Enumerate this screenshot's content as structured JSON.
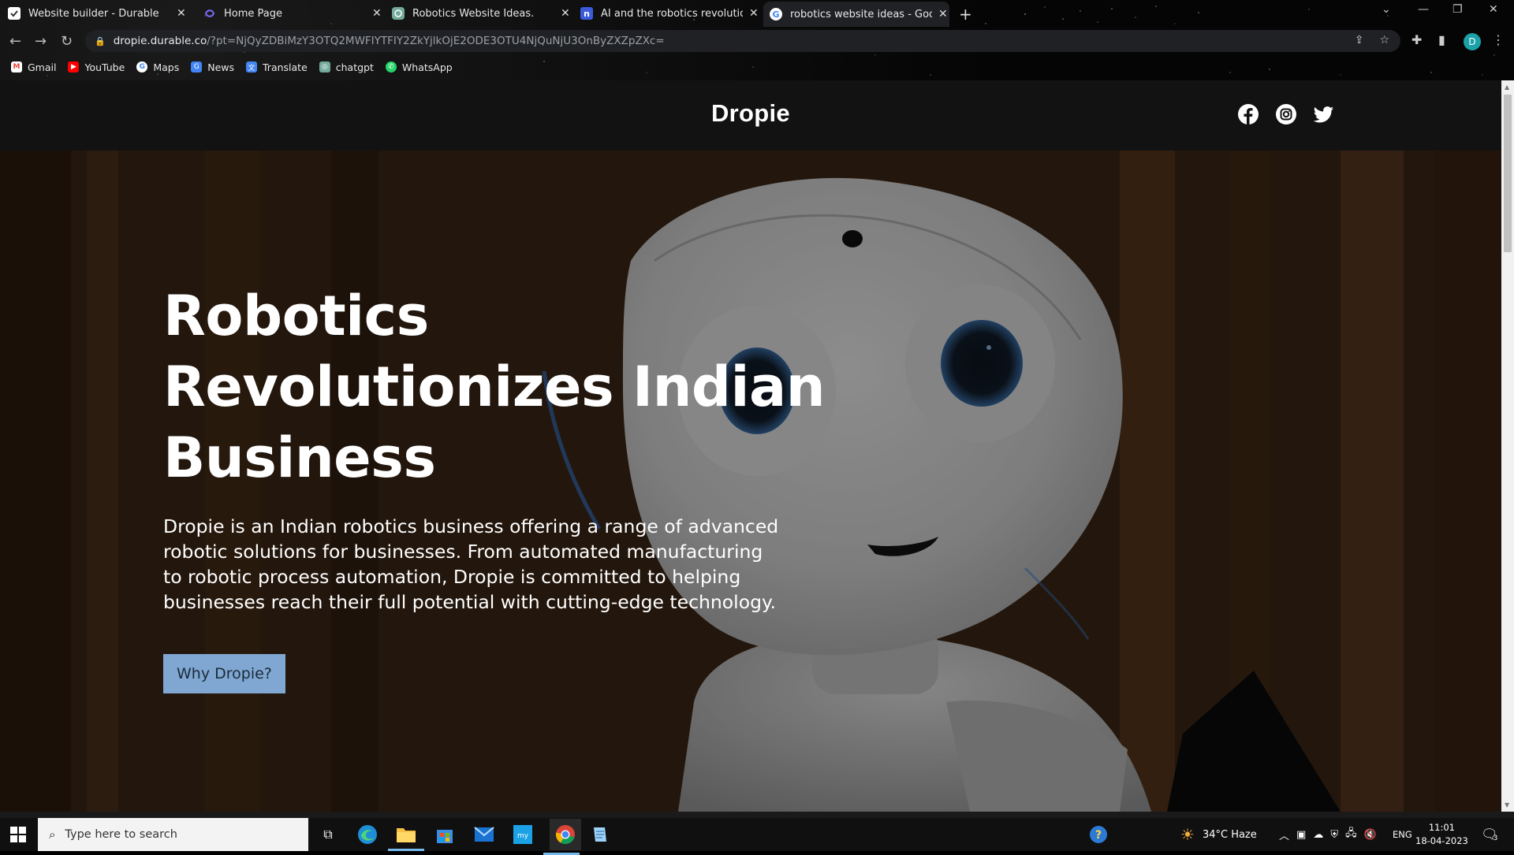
{
  "browser": {
    "tabs": [
      {
        "title": "Website builder - Durable",
        "icon": "durable-icon"
      },
      {
        "title": "Home Page",
        "icon": "home-page-icon"
      },
      {
        "title": "Robotics Website Ideas.",
        "icon": "chatgpt-icon"
      },
      {
        "title": "AI and the robotics revolution W",
        "icon": "notion-icon"
      },
      {
        "title": "robotics website ideas - Google",
        "icon": "google-icon"
      }
    ],
    "active_tab": 4,
    "url_host": "dropie.durable.co",
    "url_path": "/?pt=NjQyZDBiMzY3OTQ2MWFIYTFIY2ZkYjlkOjE2ODE3OTU4NjQuNjU3OnByZXZpZXc=",
    "profile_initial": "D",
    "bookmarks": [
      {
        "label": "Gmail",
        "icon": "gmail-icon",
        "color": "#ea4335"
      },
      {
        "label": "YouTube",
        "icon": "youtube-icon",
        "color": "#ff0000"
      },
      {
        "label": "Maps",
        "icon": "google-icon",
        "color": "#ffffff"
      },
      {
        "label": "News",
        "icon": "news-icon",
        "color": "#4285f4"
      },
      {
        "label": "Translate",
        "icon": "translate-icon",
        "color": "#4285f4"
      },
      {
        "label": "chatgpt",
        "icon": "chatgpt-icon",
        "color": "#74aa9c"
      },
      {
        "label": "WhatsApp",
        "icon": "whatsapp-icon",
        "color": "#25d366"
      }
    ]
  },
  "site": {
    "brand": "Dropie",
    "social": [
      "facebook-icon",
      "instagram-icon",
      "twitter-icon"
    ],
    "hero": {
      "title_line1": "Robotics",
      "title_line2": "Revolutionizes Indian",
      "title_line3": "Business",
      "description": "Dropie is an Indian robotics business offering a range of advanced robotic solutions for businesses. From automated manufacturing to robotic process automation, Dropie is committed to helping businesses reach their full potential with cutting-edge technology.",
      "button_label": "Why Dropie?",
      "button_color": "#7fa7d1"
    }
  },
  "taskbar": {
    "search_placeholder": "Type here to search",
    "weather": "34°C  Haze",
    "language": "ENG",
    "time": "11:01",
    "date": "18-04-2023",
    "notification_count": "3"
  }
}
